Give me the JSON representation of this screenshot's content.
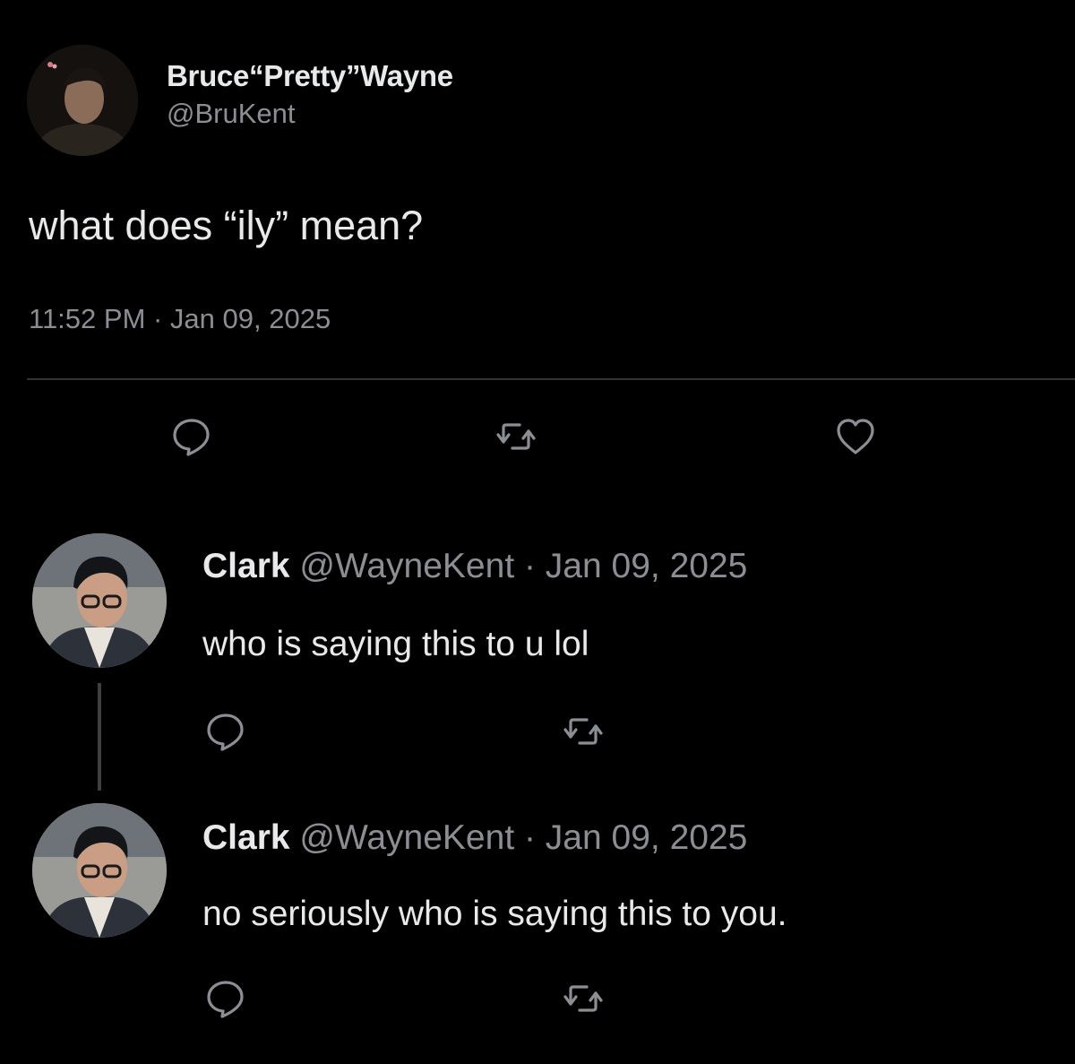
{
  "tweet": {
    "display_name": "Bruce“Pretty”Wayne",
    "handle": "@BruKent",
    "text": "what does “ily” mean?",
    "timestamp": "11:52 PM · Jan 09, 2025",
    "actions": {
      "reply_icon": "speech-bubble-icon",
      "retweet_icon": "retweet-arrows-icon",
      "like_icon": "heart-outline-icon"
    }
  },
  "replies": [
    {
      "name": "Clark",
      "meta": " @WayneKent · Jan 09, 2025",
      "text": "who is saying this to u lol"
    },
    {
      "name": "Clark",
      "meta": " @WayneKent · Jan 09, 2025",
      "text": "no seriously who is saying this to you."
    }
  ],
  "colors": {
    "background": "#000000",
    "primary_text": "#e7e9ea",
    "secondary_text": "#8b8f94",
    "divider": "#2f3336",
    "thread_line": "#3e4144",
    "icon": "#8b8f94"
  }
}
